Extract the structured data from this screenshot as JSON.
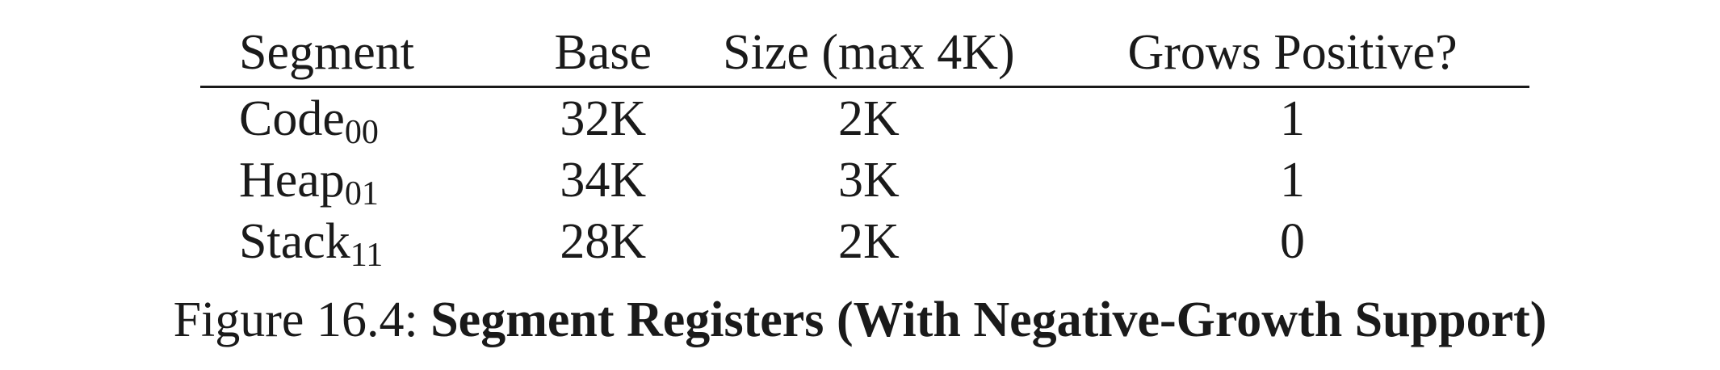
{
  "table": {
    "headers": [
      "Segment",
      "Base",
      "Size (max 4K)",
      "Grows Positive?"
    ],
    "rows": [
      {
        "segment": "Code",
        "bits": "00",
        "base": "32K",
        "size": "2K",
        "grows": "1"
      },
      {
        "segment": "Heap",
        "bits": "01",
        "base": "34K",
        "size": "3K",
        "grows": "1"
      },
      {
        "segment": "Stack",
        "bits": "11",
        "base": "28K",
        "size": "2K",
        "grows": "0"
      }
    ]
  },
  "caption": {
    "label": "Figure 16.4:",
    "title": "Segment Registers (With Negative-Growth Support)"
  }
}
